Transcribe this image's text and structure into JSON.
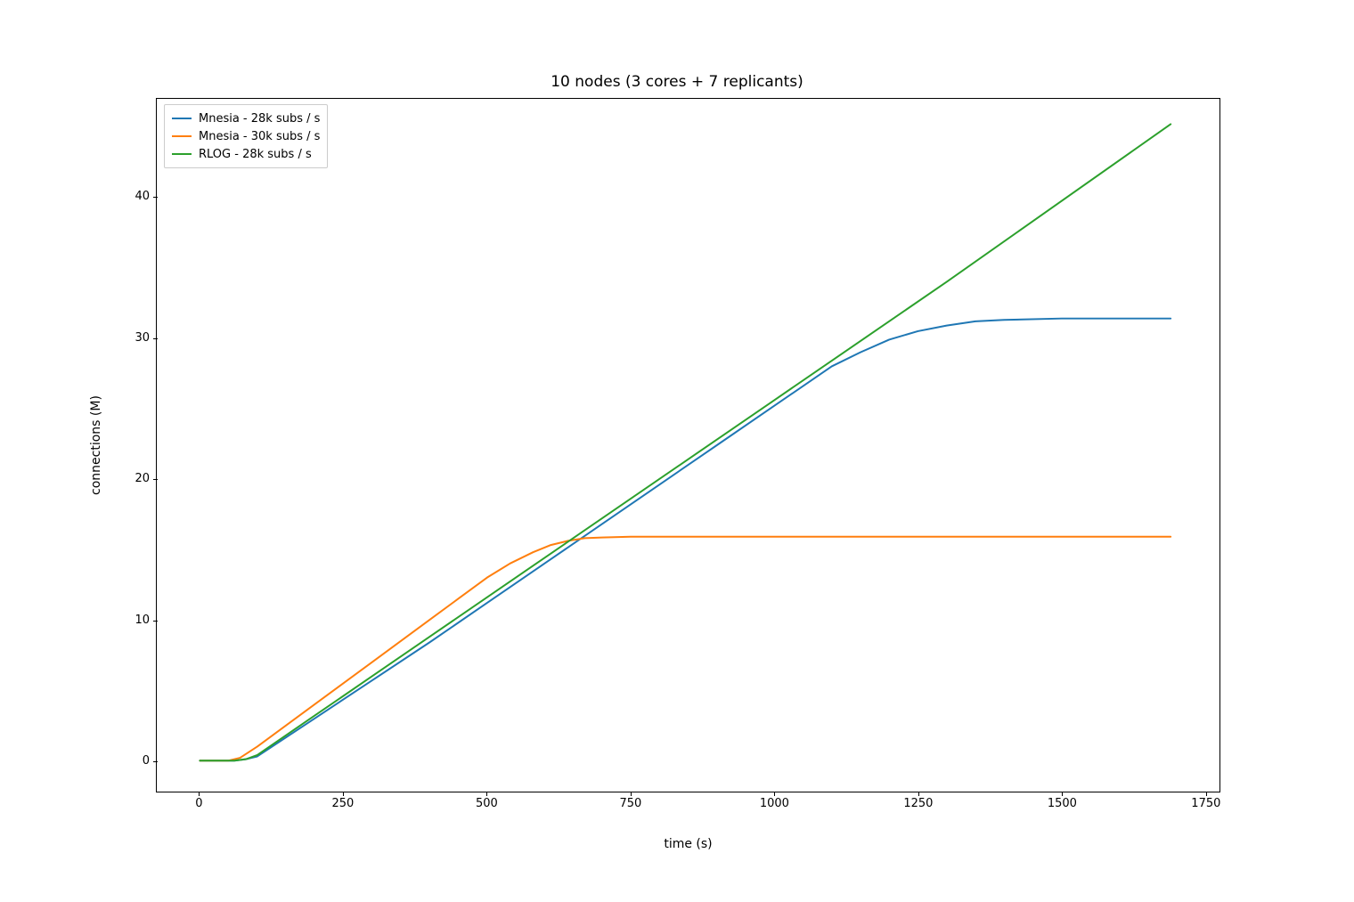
{
  "chart_data": {
    "type": "line",
    "title": "10 nodes (3 cores + 7 replicants)",
    "xlabel": "time (s)",
    "ylabel": "connections (M)",
    "xlim": [
      -75,
      1775
    ],
    "ylim": [
      -2.2,
      47
    ],
    "legend_position": "upper left",
    "x_ticks": [
      0,
      250,
      500,
      750,
      1000,
      1250,
      1500,
      1750
    ],
    "y_ticks": [
      0,
      10,
      20,
      30,
      40
    ],
    "series": [
      {
        "name": "Mnesia - 28k subs / s",
        "color": "#1f77b4",
        "x": [
          0,
          60,
          80,
          100,
          200,
          300,
          400,
          500,
          600,
          700,
          800,
          900,
          1000,
          1100,
          1150,
          1200,
          1250,
          1300,
          1350,
          1400,
          1500,
          1600,
          1690
        ],
        "values": [
          0,
          0,
          0.1,
          0.3,
          3.0,
          5.7,
          8.4,
          11.2,
          14.0,
          16.8,
          19.6,
          22.4,
          25.2,
          28.0,
          29.0,
          29.9,
          30.5,
          30.9,
          31.2,
          31.3,
          31.4,
          31.4,
          31.4
        ]
      },
      {
        "name": "Mnesia - 30k subs / s",
        "color": "#ff7f0e",
        "x": [
          0,
          50,
          70,
          100,
          200,
          300,
          400,
          450,
          500,
          540,
          580,
          610,
          640,
          670,
          700,
          750,
          900,
          1200,
          1500,
          1690
        ],
        "values": [
          0,
          0,
          0.2,
          1.0,
          4.0,
          7.0,
          10.0,
          11.5,
          13.0,
          14.0,
          14.8,
          15.3,
          15.6,
          15.8,
          15.85,
          15.9,
          15.9,
          15.9,
          15.9,
          15.9
        ]
      },
      {
        "name": "RLOG - 28k subs / s",
        "color": "#2ca02c",
        "x": [
          0,
          60,
          80,
          100,
          200,
          400,
          700,
          1000,
          1300,
          1690
        ],
        "values": [
          0,
          0,
          0.1,
          0.4,
          3.2,
          8.8,
          17.2,
          25.6,
          34.0,
          45.2
        ]
      }
    ]
  }
}
